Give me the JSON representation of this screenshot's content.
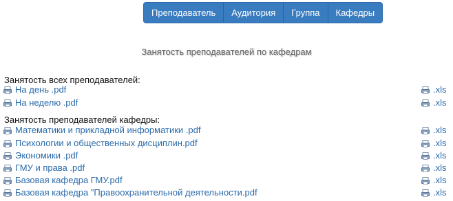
{
  "nav": {
    "tabs": [
      {
        "label": "Преподаватель"
      },
      {
        "label": "Аудитория"
      },
      {
        "label": "Группа"
      },
      {
        "label": "Кафедры"
      }
    ]
  },
  "page_title": "Занятость преподавателей по кафедрам",
  "all_teachers": {
    "heading": "Занятость всех преподавателей:",
    "links": [
      {
        "pdf": "На день .pdf",
        "xls": ".xls",
        "icon": "document-icon"
      },
      {
        "pdf": "На неделю .pdf",
        "xls": ".xls",
        "icon": "document-icon"
      }
    ]
  },
  "department_teachers": {
    "heading": "Занятость преподавателей кафедры:",
    "links": [
      {
        "pdf": "Математики и прикладной информатики .pdf",
        "xls": ".xls",
        "icon": "document-icon"
      },
      {
        "pdf": "Психологии и общественных дисциплин.pdf",
        "xls": ".xls",
        "icon": "document-icon"
      },
      {
        "pdf": "Экономики .pdf",
        "xls": ".xls",
        "icon": "document-icon"
      },
      {
        "pdf": "ГМУ и права .pdf",
        "xls": ".xls",
        "icon": "document-icon"
      },
      {
        "pdf": "Базовая кафедра ГМУ.pdf",
        "xls": ".xls",
        "icon": "document-icon"
      },
      {
        "pdf": "Базовая кафедра \"Правоохранительной деятельности.pdf",
        "xls": ".xls",
        "icon": "document-icon"
      }
    ]
  },
  "colors": {
    "link": "#2a6aab",
    "nav_bg": "#3a7cc0",
    "title": "#666666"
  }
}
